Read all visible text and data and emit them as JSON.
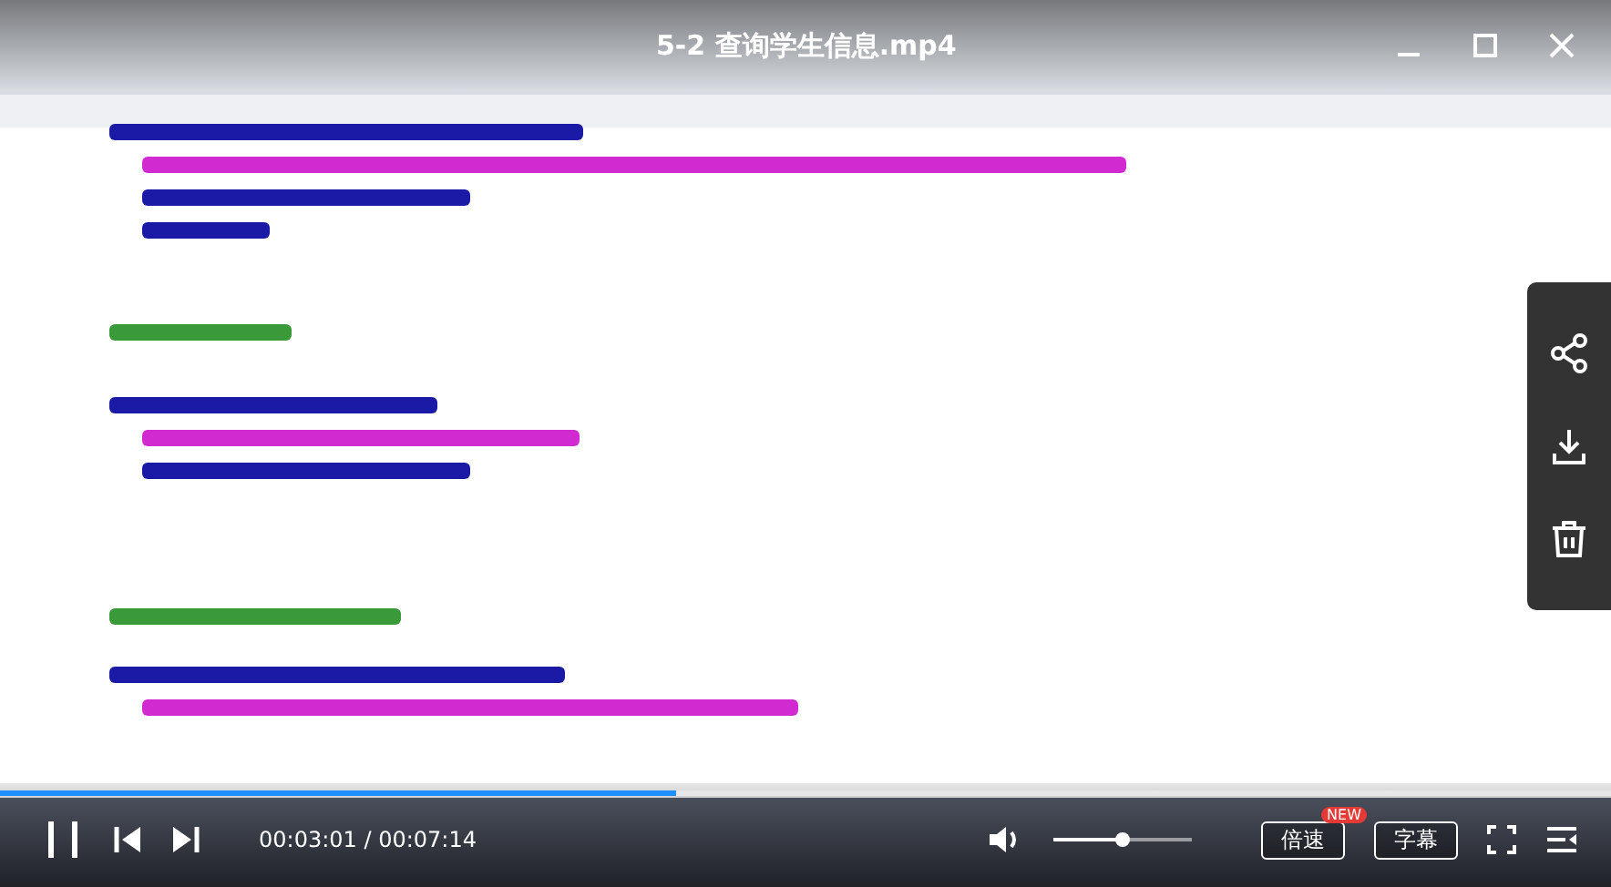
{
  "title": "5-2 查询学生信息.mp4",
  "progress": {
    "level": 0.42
  },
  "time": "00:03:01 / 00:07:14",
  "volume": {
    "level": 0.5
  },
  "buttons": [
    {
      "label": "倍速",
      "badge": "NEW"
    },
    {
      "label": "字幕"
    }
  ]
}
